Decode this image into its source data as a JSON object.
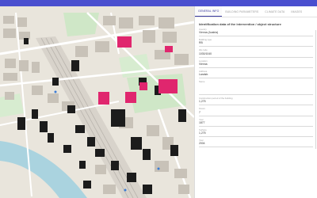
{
  "app": {
    "accent": "#4a4fcf"
  },
  "tabs": [
    {
      "label": "GENERAL INFO",
      "active": true
    },
    {
      "label": "BUILDING PARAMETERS",
      "active": false
    },
    {
      "label": "CLIMATE DATA",
      "active": false
    },
    {
      "label": "IMAGES",
      "active": false
    }
  ],
  "panel": {
    "section_title": "Identification data of the intervention / object structure",
    "fields": [
      {
        "label": "Country",
        "value": "Vienna (Austria)"
      },
      {
        "label": "Building type",
        "value": "RB"
      },
      {
        "label": "Zip code",
        "value": "1030/1040"
      },
      {
        "label": "Location",
        "value": "Vienna"
      },
      {
        "label": "Address",
        "value": "Landstr."
      },
      {
        "label": "Name",
        "value": ""
      },
      {
        "label": "Construction period of the building",
        "value": "1,275"
      },
      {
        "label": "Floors",
        "value": "7"
      },
      {
        "label": "Year",
        "value": "1877"
      },
      {
        "label": "Surface",
        "value": "1,275"
      },
      {
        "label": "Year",
        "value": "2004"
      }
    ]
  },
  "map": {
    "colors": {
      "background": "#e9e5dc",
      "building": "#c8c2b8",
      "building_dark": "#1c1c1c",
      "highlight": "#e0266e",
      "park": "#cfe7c7",
      "water": "#aad3df",
      "road": "#ffffff",
      "rail": "#b9b4ad"
    }
  }
}
